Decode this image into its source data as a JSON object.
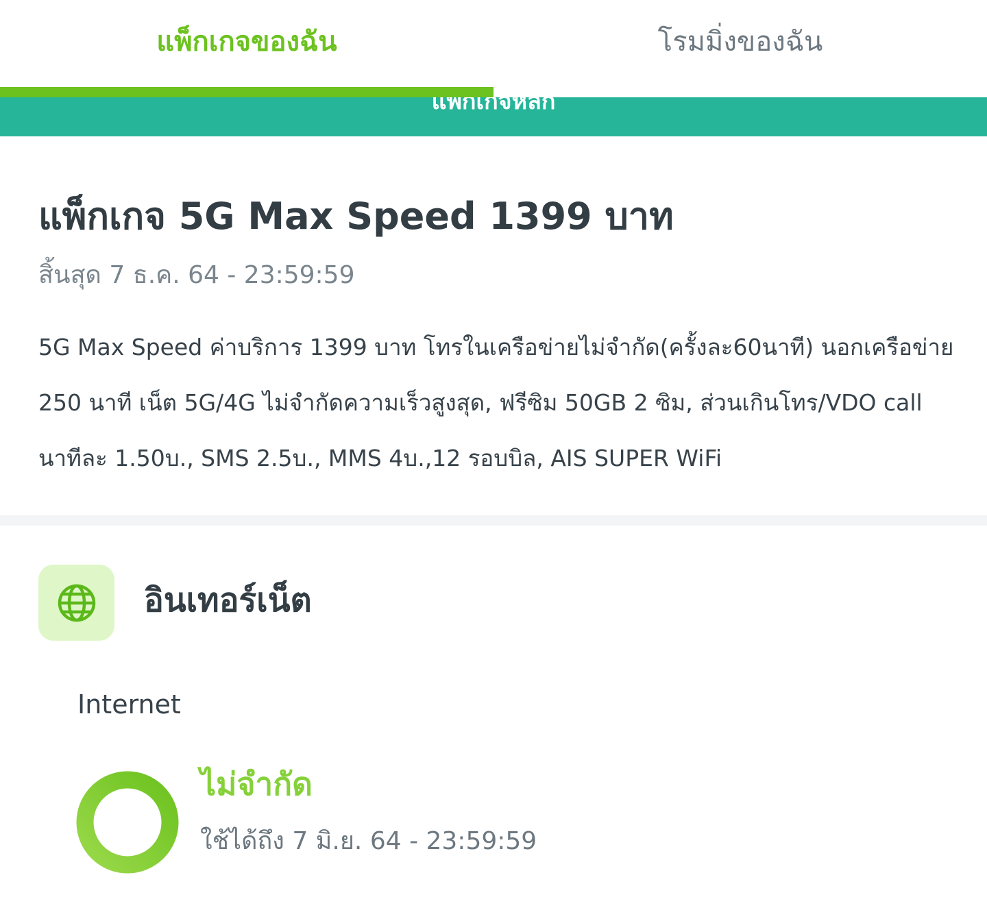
{
  "tabs": [
    {
      "label": "แพ็กเกจของฉัน",
      "active": true
    },
    {
      "label": "โรมมิ่งของฉัน",
      "active": false
    }
  ],
  "banner": {
    "text": "แพ็กเกจหลัก"
  },
  "package": {
    "title": "แพ็กเกจ 5G Max Speed 1399 บาท",
    "expiry": "สิ้นสุด 7 ธ.ค. 64 - 23:59:59",
    "description": "5G Max Speed ค่าบริการ 1399 บาท โทรในเครือข่ายไม่จำกัด(ครั้งละ60นาที) นอกเครือข่าย 250 นาที เน็ต 5G/4G ไม่จำกัดความเร็วสูงสุด, ฟรีซิม 50GB 2 ซิม, ส่วนเกินโทร/VDO call นาทีละ 1.50บ., SMS 2.5บ., MMS 4บ.,12 รอบบิล, AIS SUPER WiFi"
  },
  "internet": {
    "section_title": "อินเทอร์เน็ต",
    "icon": "globe-icon",
    "label": "Internet",
    "usage_value": "ไม่จำกัด",
    "valid_until": "ใช้ได้ถึง 7 มิ.ย. 64 - 23:59:59",
    "remaining_fraction": 1.0
  },
  "colors": {
    "accent": "#6cc21f",
    "banner": "#27b59a",
    "icon_bg": "#dff7c8",
    "unlimited_text": "#86d13a"
  }
}
